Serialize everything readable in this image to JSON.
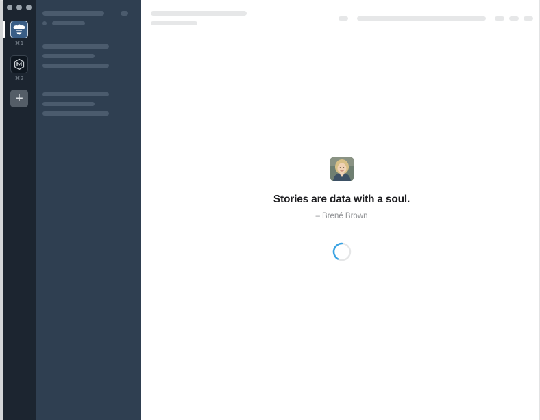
{
  "workspaces": [
    {
      "icon": "bee-icon",
      "shortcut": "⌘1",
      "active": true
    },
    {
      "icon": "m-hexagon-icon",
      "shortcut": "⌘2",
      "active": false
    }
  ],
  "add_workspace_label": "+",
  "loading": {
    "quote": "Stories are data with a soul.",
    "author": "– Brené Brown"
  },
  "colors": {
    "switcher_bg": "#1c2530",
    "sidebar_bg": "#2f3f51",
    "spinner": "#3aa3e3"
  }
}
